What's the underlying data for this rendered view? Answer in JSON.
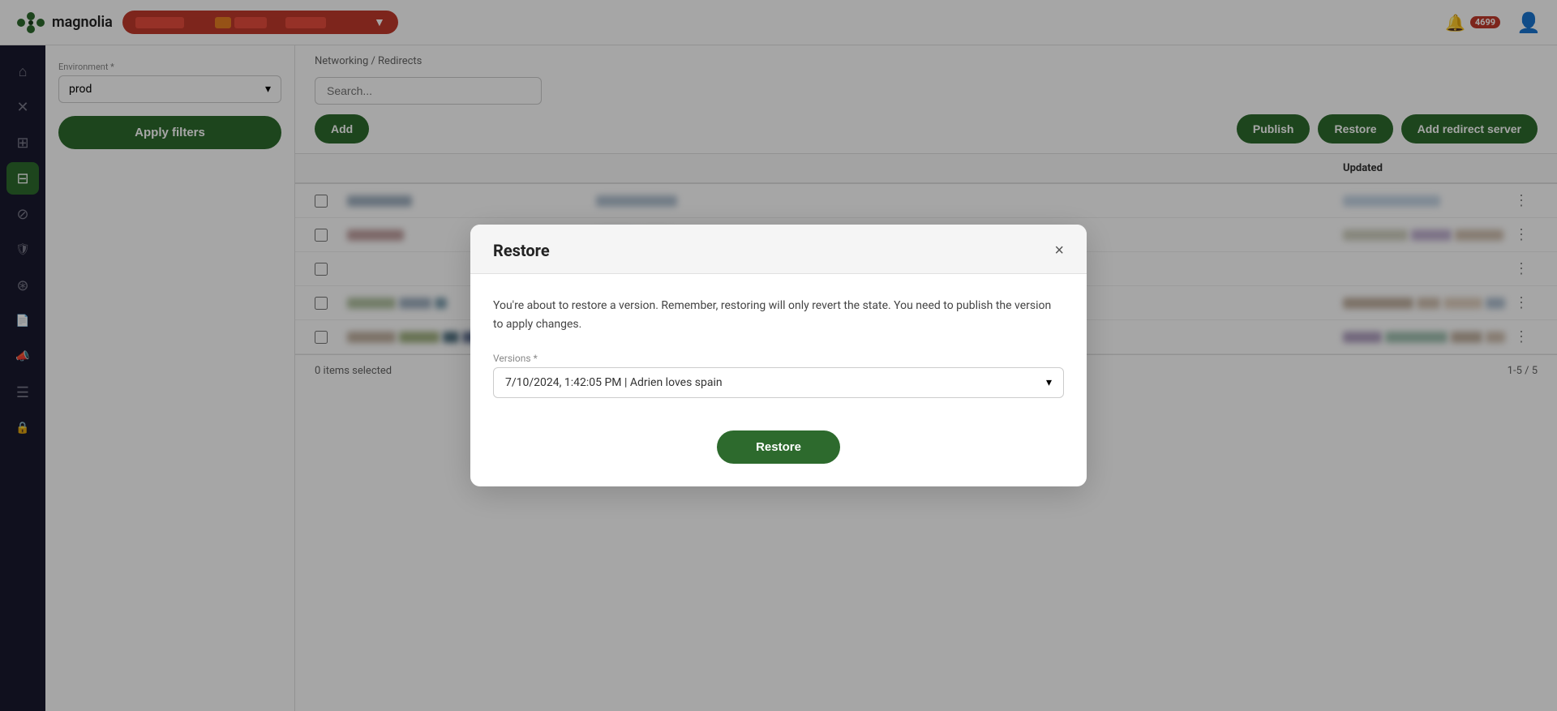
{
  "topbar": {
    "logo_text": "magnolia",
    "notification_count": "4699",
    "status_bar_aria": "deployment status"
  },
  "sidebar": {
    "items": [
      {
        "id": "home",
        "icon": "⌂",
        "active": false
      },
      {
        "id": "close",
        "icon": "✕",
        "active": false
      },
      {
        "id": "layers",
        "icon": "⊞",
        "active": false
      },
      {
        "id": "dashboard",
        "icon": "⊟",
        "active": true,
        "green": true
      },
      {
        "id": "block",
        "icon": "⊘",
        "active": false
      },
      {
        "id": "shield",
        "icon": "🛡",
        "active": false
      },
      {
        "id": "settings-circle",
        "icon": "⊛",
        "active": false
      },
      {
        "id": "document",
        "icon": "📄",
        "active": false
      },
      {
        "id": "megaphone",
        "icon": "📣",
        "active": false
      },
      {
        "id": "list",
        "icon": "☰",
        "active": false
      },
      {
        "id": "lock",
        "icon": "🔒",
        "active": false
      }
    ]
  },
  "left_panel": {
    "env_label": "Environment *",
    "env_value": "prod",
    "apply_filters_label": "Apply filters"
  },
  "content": {
    "breadcrumb": "Networking / Redirects",
    "search_placeholder": "Search...",
    "toolbar": {
      "add_label": "Add",
      "publish_label": "Publish",
      "restore_label": "Restore",
      "add_redirect_server_label": "Add redirect server"
    },
    "table": {
      "header": [
        "",
        "",
        "",
        "",
        "",
        "Updated",
        ""
      ],
      "footer_selected": "0 items selected",
      "footer_pagination": "1-5 / 5"
    }
  },
  "modal": {
    "title": "Restore",
    "close_label": "×",
    "description": "You're about to restore a version. Remember, restoring will only revert the state. You need to publish the version to apply changes.",
    "versions_label": "Versions *",
    "versions_value": "7/10/2024, 1:42:05 PM | Adrien loves spain",
    "restore_button_label": "Restore"
  }
}
